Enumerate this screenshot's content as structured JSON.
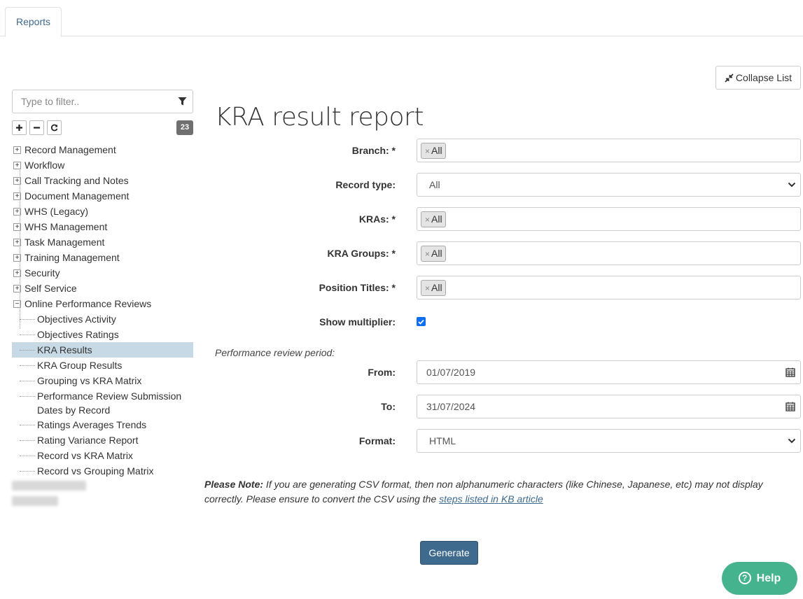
{
  "tabs": [
    {
      "label": "Reports",
      "active": true
    }
  ],
  "collapse_button": {
    "label": "Collapse List",
    "icon": "compress-icon"
  },
  "sidebar": {
    "filter_placeholder": "Type to filter..",
    "count": "23",
    "nodes": [
      {
        "label": "Record Management",
        "expanded": false
      },
      {
        "label": "Workflow",
        "expanded": false
      },
      {
        "label": "Call Tracking and Notes",
        "expanded": false
      },
      {
        "label": "Document Management",
        "expanded": false
      },
      {
        "label": "WHS (Legacy)",
        "expanded": false
      },
      {
        "label": "WHS Management",
        "expanded": false
      },
      {
        "label": "Task Management",
        "expanded": false
      },
      {
        "label": "Training Management",
        "expanded": false
      },
      {
        "label": "Security",
        "expanded": false
      },
      {
        "label": "Self Service",
        "expanded": false
      },
      {
        "label": "Online Performance Reviews",
        "expanded": true
      }
    ],
    "children": [
      {
        "label": "Objectives Activity"
      },
      {
        "label": "Objectives Ratings"
      },
      {
        "label": "KRA Results",
        "active": true
      },
      {
        "label": "KRA Group Results"
      },
      {
        "label": "Grouping vs KRA Matrix"
      },
      {
        "label": "Performance Review Submission Dates by Record"
      },
      {
        "label": "Ratings Averages Trends"
      },
      {
        "label": "Rating Variance Report"
      },
      {
        "label": "Record vs KRA Matrix"
      },
      {
        "label": "Record vs Grouping Matrix"
      }
    ]
  },
  "main": {
    "title": "KRA result report",
    "branch": {
      "label": "Branch: *",
      "tag": "All"
    },
    "record_type": {
      "label": "Record type:",
      "value": "All"
    },
    "kras": {
      "label": "KRAs: *",
      "tag": "All"
    },
    "kra_groups": {
      "label": "KRA Groups: *",
      "tag": "All"
    },
    "position_titles": {
      "label": "Position Titles: *",
      "tag": "All"
    },
    "show_multiplier": {
      "label": "Show multiplier:",
      "checked": true
    },
    "period_label": "Performance review period:",
    "from": {
      "label": "From:",
      "value": "01/07/2019"
    },
    "to": {
      "label": "To:",
      "value": "31/07/2024"
    },
    "format": {
      "label": "Format:",
      "value": "HTML"
    },
    "note": {
      "bold": "Please Note:",
      "text1": " If you are generating CSV format, then non alphanumeric characters (like Chinese, Japanese, etc) may not display correctly. Please ensure to convert the CSV using the ",
      "link": "steps listed in KB article"
    },
    "generate_label": "Generate"
  },
  "help": {
    "label": "Help"
  },
  "colors": {
    "accent": "#3e6a8e",
    "help": "#45b38d",
    "active_row": "#c8d9e6",
    "checkbox": "#0b6ef5"
  }
}
